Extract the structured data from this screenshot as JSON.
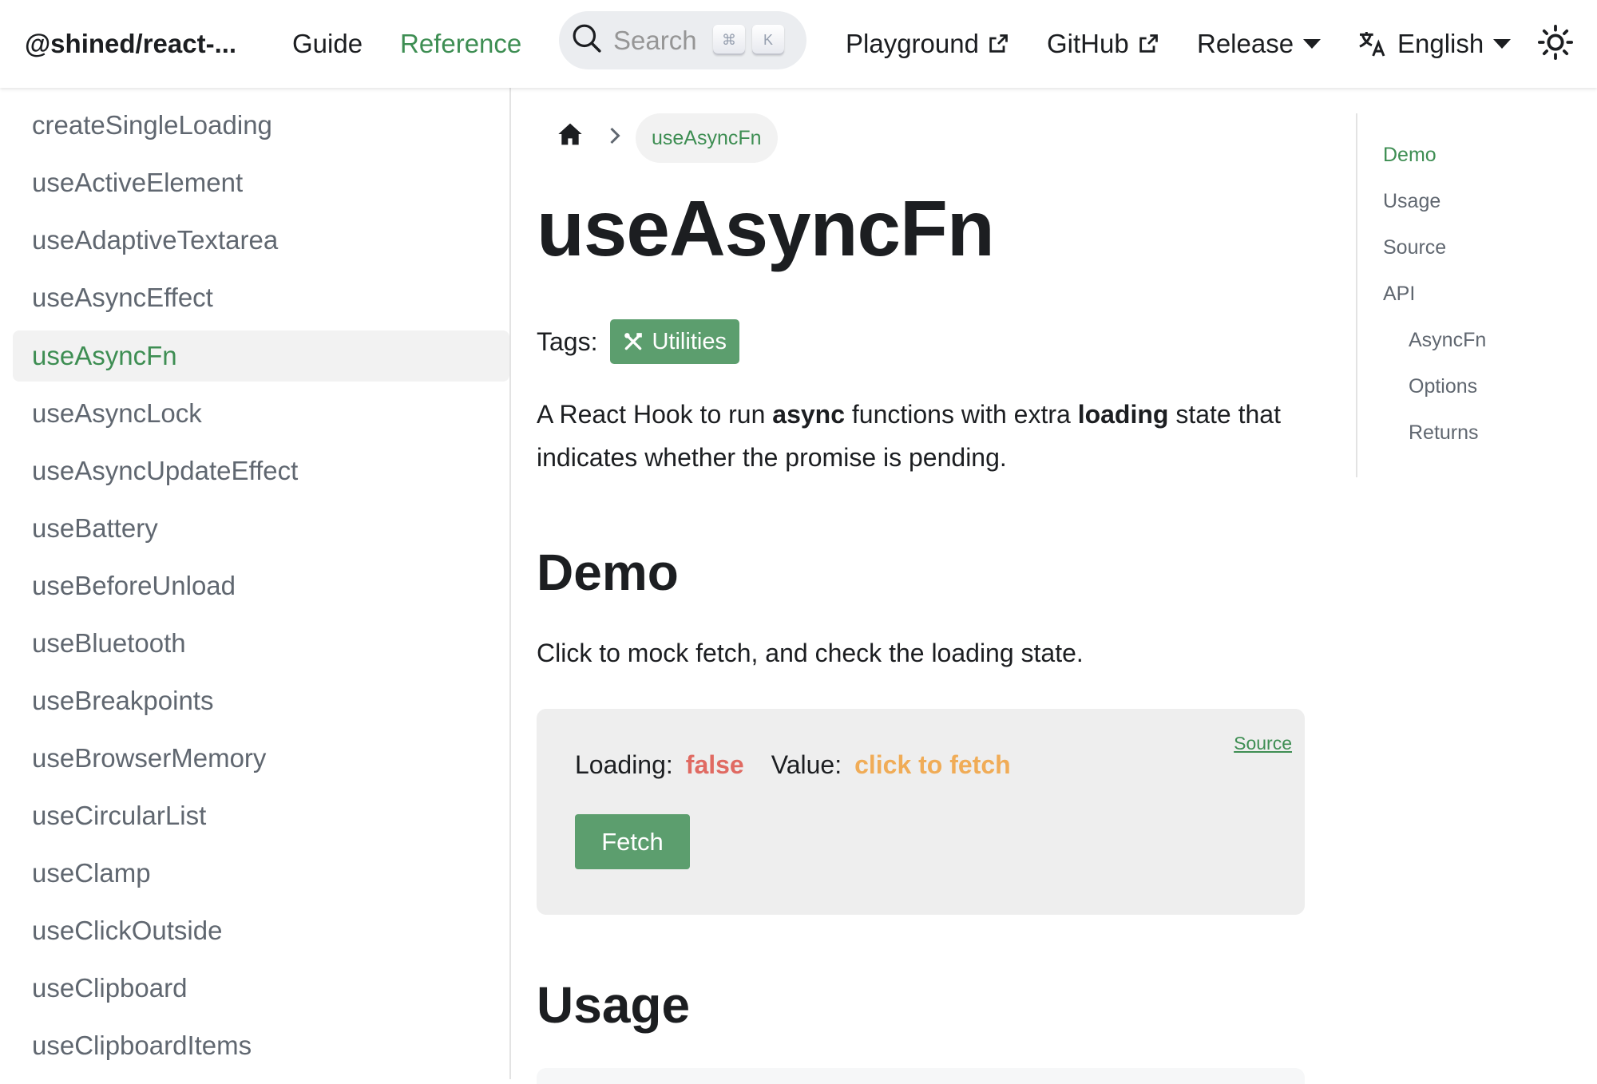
{
  "navbar": {
    "brand": "@shined/react-...",
    "links": {
      "guide": "Guide",
      "reference": "Reference",
      "playground": "Playground",
      "github": "GitHub",
      "release": "Release",
      "language": "English"
    },
    "search": {
      "placeholder": "Search",
      "shortcut_mod": "⌘",
      "shortcut_key": "K"
    }
  },
  "sidebar": {
    "items": [
      {
        "label": "createSingleLoading"
      },
      {
        "label": "useActiveElement"
      },
      {
        "label": "useAdaptiveTextarea"
      },
      {
        "label": "useAsyncEffect"
      },
      {
        "label": "useAsyncFn",
        "active": true
      },
      {
        "label": "useAsyncLock"
      },
      {
        "label": "useAsyncUpdateEffect"
      },
      {
        "label": "useBattery"
      },
      {
        "label": "useBeforeUnload"
      },
      {
        "label": "useBluetooth"
      },
      {
        "label": "useBreakpoints"
      },
      {
        "label": "useBrowserMemory"
      },
      {
        "label": "useCircularList"
      },
      {
        "label": "useClamp"
      },
      {
        "label": "useClickOutside"
      },
      {
        "label": "useClipboard"
      },
      {
        "label": "useClipboardItems"
      }
    ]
  },
  "main": {
    "breadcrumb": {
      "current": "useAsyncFn"
    },
    "title": "useAsyncFn",
    "tags_label": "Tags:",
    "tag": "Utilities",
    "description": {
      "part1": "A React Hook to run ",
      "bold1": "async",
      "part2": " functions with extra ",
      "bold2": "loading",
      "part3": " state that indicates whether the promise is pending."
    },
    "sections": {
      "demo": "Demo",
      "usage": "Usage"
    },
    "demo": {
      "intro": "Click to mock fetch, and check the loading state.",
      "source_link": "Source",
      "loading_label": "Loading:",
      "loading_value": "false",
      "value_label": "Value:",
      "value_value": "click to fetch",
      "fetch_button": "Fetch"
    }
  },
  "toc": {
    "items": [
      {
        "label": "Demo",
        "active": true,
        "level": 1
      },
      {
        "label": "Usage",
        "level": 1
      },
      {
        "label": "Source",
        "level": 1
      },
      {
        "label": "API",
        "level": 1
      },
      {
        "label": "AsyncFn",
        "level": 2
      },
      {
        "label": "Options",
        "level": 2
      },
      {
        "label": "Returns",
        "level": 2
      }
    ]
  },
  "colors": {
    "accent": "#3e8e53",
    "button": "#5c9e6e",
    "false_value": "#e06a62",
    "fetch_value": "#f0ac57"
  }
}
